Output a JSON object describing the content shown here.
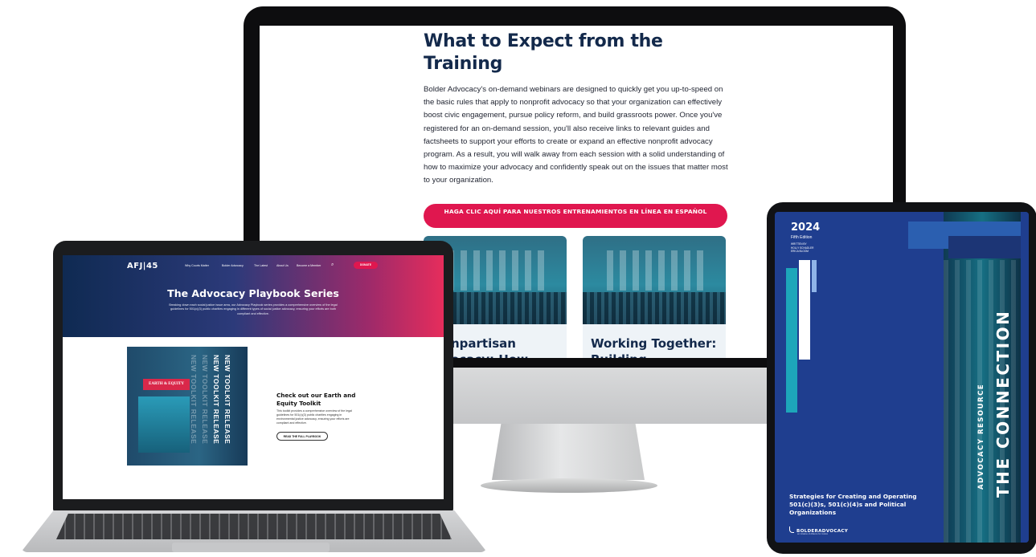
{
  "monitor": {
    "title": "What to Expect from the Training",
    "paragraph": "Bolder Advocacy's on-demand webinars are designed to quickly get you up-to-speed on the basic rules that apply to nonprofit advocacy so that your organization can effectively boost civic engagement, pursue policy reform, and build grassroots power. Once you've registered for an on-demand session, you'll also receive links to relevant guides and factsheets to support your efforts to create or expand an effective nonprofit advocacy program. As a result, you will walk away from each session with a solid understanding of how to maximize your advocacy and confidently speak out on the issues that matter most to your organization.",
    "cta_label": "HAGA CLIC AQUÍ PARA NUESTROS ENTRENAMIENTOS EN LÍNEA EN ESPAÑOL",
    "cards": [
      {
        "title": "npartisan",
        "title_line2": "ocacy: How"
      },
      {
        "title": "Working Together:",
        "title_line2": "Building"
      }
    ]
  },
  "laptop": {
    "logo": "AFJ|45",
    "nav": [
      "Why Courts Matter",
      "Bolder Advocacy",
      "The Latest",
      "About Us",
      "Become a Member"
    ],
    "search_icon": "search-icon",
    "donate_label": "DONATE",
    "hero_title": "The Advocacy Playbook Series",
    "hero_desc": "Breaking down each social justice issue area, our Advocacy Playbook series provides a comprehensive overview of the legal guidelines for 501(c)(3) public charities engaging in different types of social justice advocacy, ensuring your efforts are both compliant and effective.",
    "cover_badge": "EARTH & EQUITY",
    "cover_vertical": [
      "NEW TOOLKIT RELEASE",
      "NEW TOOLKIT RELEASE",
      "NEW TOOLKIT RELEASE",
      "NEW TOOLKIT RELEASE"
    ],
    "feature_title": "Check out our Earth and Equity Toolkit",
    "feature_desc": "This toolkit provides a comprehensive overview of the legal guidelines for 501(c)(3) public charities engaging in environmental justice advocacy, ensuring your efforts are compliant and effective.",
    "feature_button": "READ THE FULL PLAYBOOK"
  },
  "tablet": {
    "year": "2024",
    "edition": "Fifth Edition",
    "authors": [
      "WRITTEN BY",
      "HOLLY SCHADLER",
      "ERICA BLOOM"
    ],
    "vertical_small": "ADVOCACY RESOURCE",
    "vertical_big": "THE CONNECTION",
    "strategy": "Strategies for Creating and Operating 501(c)(3)s, 501(c)(4)s and Political Organizations",
    "logo_text": "BOLDERADVOCACY",
    "logo_sub": "an initiative of Alliance for Justice"
  },
  "colors": {
    "navy": "#13294b",
    "cta": "#e0174f",
    "tablet_blue": "#1f3e8f",
    "teal": "#1da6ba"
  }
}
